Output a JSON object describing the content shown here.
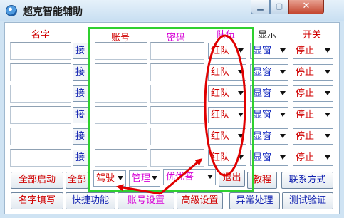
{
  "window": {
    "title": "超克智能辅助",
    "minimize_glyph": "▁",
    "maximize_glyph": "▢",
    "close_glyph": "✕"
  },
  "headers": {
    "name": "名字",
    "account": "账号",
    "password": "密码",
    "team": "队伍",
    "display": "显示",
    "switch": "开关"
  },
  "rows": [
    {
      "connect": "接",
      "team": "红队",
      "display": "显窗",
      "switch": "停止"
    },
    {
      "connect": "接",
      "team": "红队",
      "display": "显窗",
      "switch": "停止"
    },
    {
      "connect": "接",
      "team": "红队",
      "display": "显窗",
      "switch": "停止"
    },
    {
      "connect": "接",
      "team": "红队",
      "display": "显窗",
      "switch": "停止"
    },
    {
      "connect": "接",
      "team": "红队",
      "display": "显窗",
      "switch": "停止"
    },
    {
      "connect": "接",
      "team": "红队",
      "display": "显窗",
      "switch": "停止"
    }
  ],
  "bottom": {
    "start_all": "全部启动",
    "all_partial": "全部",
    "driver_combo": "驾驶",
    "manage_combo": "管理",
    "priority_combo": "优优答",
    "exit": "退出",
    "tutorial": "教程",
    "contact": "联系方式",
    "fill_names": "名字填写",
    "shortcuts": "快捷功能",
    "account_settings": "账号设置",
    "advanced_settings": "高级设置",
    "exception_handling": "异常处理",
    "test_verify": "测试验证"
  },
  "colors": {
    "annotation_red": "#e00000",
    "annotation_green": "#2fd02f",
    "red_text": "#d00000",
    "magenta_text": "#d600d6",
    "blue_text": "#1020b0"
  }
}
